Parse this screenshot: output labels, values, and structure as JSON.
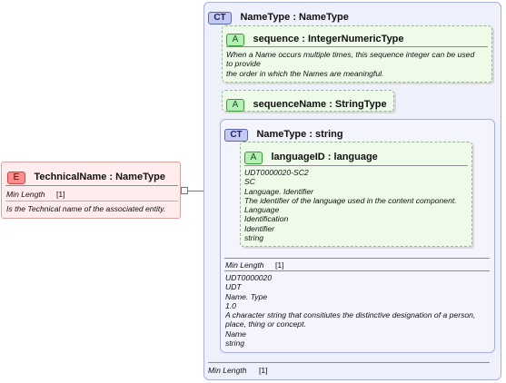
{
  "element": {
    "badge": "E",
    "title": "TechnicalName : NameType",
    "facet_name": "Min Length",
    "facet_value": "[1]",
    "doc": "Is the Technical name of the associated entity."
  },
  "complex_type": {
    "badge": "CT",
    "title": "NameType : NameType",
    "facet_name": "Min Length",
    "facet_value": "[1]"
  },
  "attr_sequence": {
    "badge": "A",
    "title": "sequence : IntegerNumericType",
    "doc_lines": [
      "When a Name occurs multiple times, this sequence integer can be used",
      "to provide",
      "the order in which the Names are meaningful."
    ]
  },
  "attr_sequence_name": {
    "badge": "A",
    "title": "sequenceName : StringType"
  },
  "inner_type": {
    "badge": "CT",
    "title": "NameType : string",
    "facet_name": "Min Length",
    "facet_value": "[1]",
    "doc_lines": [
      "UDT0000020",
      "UDT",
      "Name. Type",
      "1.0",
      "A character string that consitiutes the distinctive designation of a person,",
      "place, thing or concept.",
      "Name",
      "string"
    ]
  },
  "attr_language": {
    "badge": "A",
    "title": "languageID : language",
    "doc_lines": [
      "UDT0000020-SC2",
      "SC",
      "Language. Identifier",
      "The identifier of the language used in the content component.",
      "Language",
      "Identification",
      "Identifier",
      "string"
    ]
  }
}
